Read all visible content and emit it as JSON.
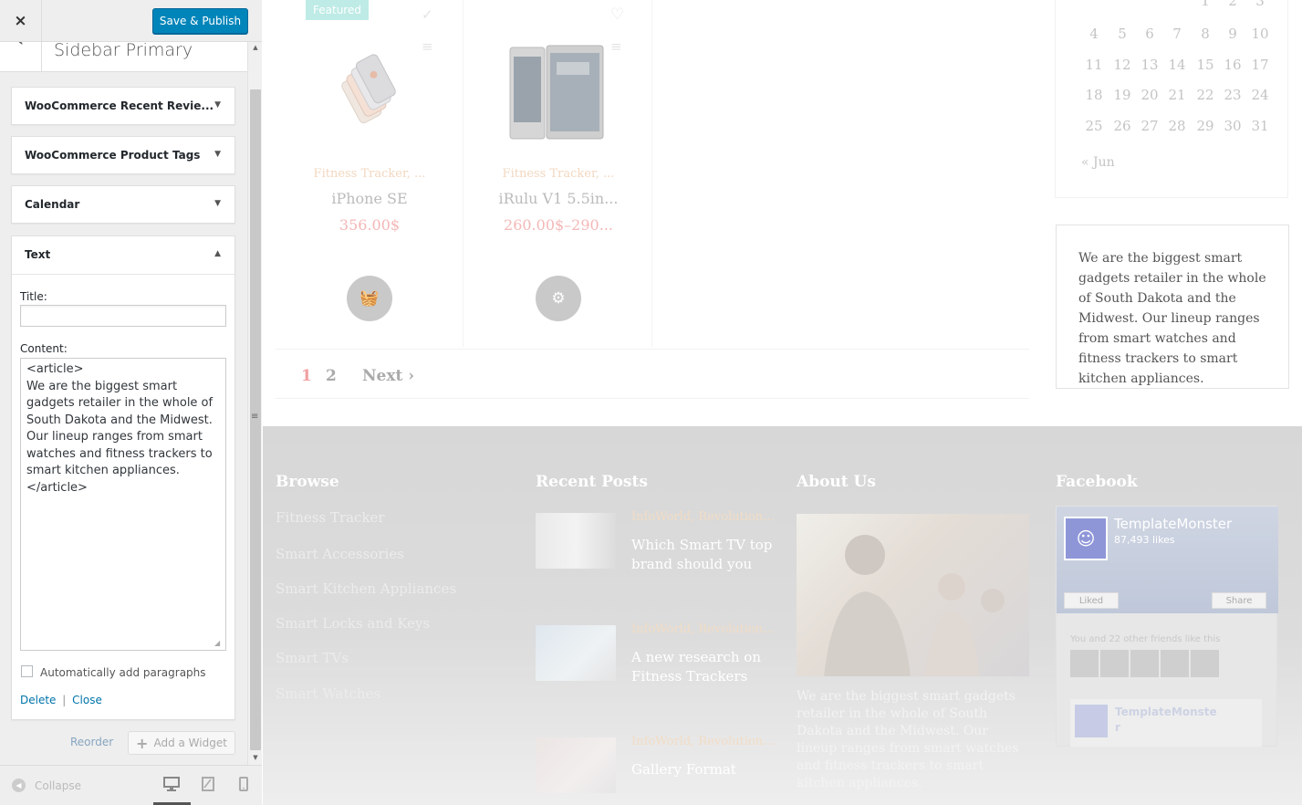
{
  "customizer": {
    "close_icon": "×",
    "save_label": "Save & Publish",
    "back_icon": "‹",
    "section_title": "Sidebar Primary",
    "widgets": [
      {
        "title": "WooCommerce Recent Revie...",
        "arrow": "▼"
      },
      {
        "title": "WooCommerce Product Tags",
        "arrow": "▼"
      },
      {
        "title": "Calendar",
        "arrow": "▼"
      }
    ],
    "text_widget": {
      "title": "Text",
      "arrow": "▲",
      "title_label": "Title:",
      "title_value": "",
      "content_label": "Content:",
      "content_value": "<article>\nWe are the biggest smart gadgets retailer in the whole of South Dakota and the Midwest. Our lineup ranges from smart watches and fitness trackers to smart kitchen appliances.\n</article>",
      "auto_paragraphs_label": "Automatically add paragraphs",
      "auto_paragraphs_checked": false,
      "delete_label": "Delete",
      "separator": "|",
      "close_label": "Close"
    },
    "reorder_label": "Reorder",
    "add_widget_label": "Add a Widget",
    "collapse_label": "Collapse",
    "devices": [
      "desktop-icon",
      "tablet-icon",
      "mobile-icon"
    ]
  },
  "preview": {
    "products": [
      {
        "badge": "Featured",
        "category": "Fitness Tracker, ...",
        "name": "iPhone SE",
        "price": "356.00$"
      },
      {
        "badge": "",
        "category": "Fitness Tracker, ...",
        "name": "iRulu V1 5.5in...",
        "price": "260.00$–290..."
      }
    ],
    "pagination": {
      "page1": "1",
      "page2": "2",
      "next": "Next ›"
    },
    "calendar": {
      "rows": [
        [
          "",
          "",
          "",
          "",
          "1",
          "2",
          "3"
        ],
        [
          "4",
          "5",
          "6",
          "7",
          "8",
          "9",
          "10"
        ],
        [
          "11",
          "12",
          "13",
          "14",
          "15",
          "16",
          "17"
        ],
        [
          "18",
          "19",
          "20",
          "21",
          "22",
          "23",
          "24"
        ],
        [
          "25",
          "26",
          "27",
          "28",
          "29",
          "30",
          "31"
        ]
      ],
      "prev_month": "« Jun"
    },
    "text_widget_content": "We are the biggest smart gadgets retailer in the whole of South Dakota and the Midwest. Our lineup ranges from smart watches and fitness trackers to smart kitchen appliances.",
    "footer": {
      "browse_title": "Browse",
      "browse_links": [
        "Fitness Tracker",
        "Smart Accessories",
        "Smart Kitchen Appliances",
        "Smart Locks and Keys",
        "Smart TVs",
        "Smart Watches"
      ],
      "recent_title": "Recent Posts",
      "posts": [
        {
          "category": "InfoWorld, Revolution...",
          "title": "Which Smart TV top\nbrand should you"
        },
        {
          "category": "InfoWorld, Revolution...",
          "title": "A new research on\nFitness Trackers"
        },
        {
          "category": "InfoWorld, Revolution...",
          "title": "Gallery Format"
        }
      ],
      "about_title": "About Us",
      "about_text": "We are the biggest smart gadgets retailer in the whole of South Dakota and the Midwest. Our lineup ranges from smart watches and fitness trackers to smart kitchen appliances.",
      "facebook_title": "Facebook",
      "fb_page_name": "TemplateMonster",
      "fb_likes": "87,493 likes",
      "fb_liked_label": "Liked",
      "fb_share_label": "Share",
      "fb_friends_text": "You and 22 other friends like this",
      "fb_post_name": "TemplateMonste\nr"
    }
  },
  "colors": {
    "primary_button": "#0085ba",
    "link": "#0073aa",
    "price": "#f4b7b7",
    "footer_bg": "#d7d7d7"
  }
}
